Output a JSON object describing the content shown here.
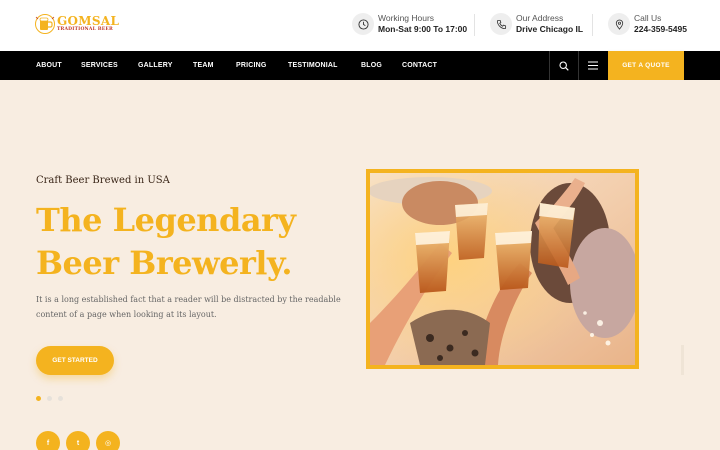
{
  "brand": {
    "name": "GOMSAL",
    "tagline": "TRADITIONAL BEER",
    "color": "#f4b31f"
  },
  "header": {
    "working_hours": {
      "label": "Working Hours",
      "value": "Mon-Sat 9:00 To 17:00",
      "icon": "clock-icon"
    },
    "address": {
      "label": "Our Address",
      "value": "Drive Chicago IL",
      "icon": "phone-icon"
    },
    "call": {
      "label": "Call Us",
      "value": "224-359-5495",
      "icon": "location-icon"
    }
  },
  "nav": {
    "items": [
      "ABOUT",
      "SERVICES",
      "GALLERY",
      "TEAM",
      "PRICING",
      "TESTIMONIAL",
      "BLOG",
      "CONTACT"
    ],
    "search_icon": "search-icon",
    "menu_icon": "hamburger-menu-icon",
    "quote_label": "GET A QUOTE"
  },
  "hero": {
    "subtitle": "Craft Beer Brewed in USA",
    "title_line1": "The Legendary",
    "title_line2": "Beer Brewerly.",
    "description": "It is a long established fact that a reader will be distracted by the readable content of a page when looking at its layout.",
    "cta_label": "GET STARTED",
    "slides_total": 3,
    "active_slide": 1,
    "photo_alt": "friends toasting with beer cups"
  },
  "social": [
    {
      "name": "facebook",
      "glyph": "f"
    },
    {
      "name": "twitter",
      "glyph": "t"
    },
    {
      "name": "instagram",
      "glyph": "◎"
    }
  ],
  "colors": {
    "accent": "#f4b31f",
    "hero_bg": "#f8ede1",
    "nav_bg": "#000000",
    "heading_dark": "#3a2618"
  }
}
